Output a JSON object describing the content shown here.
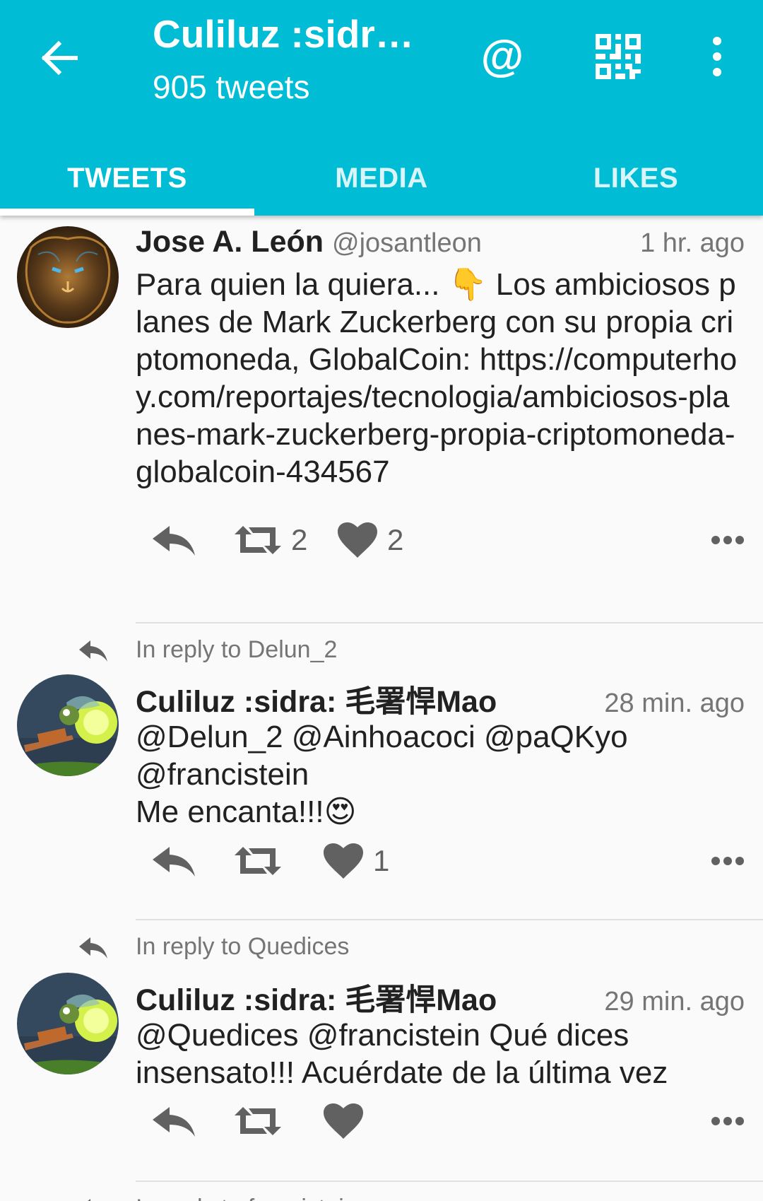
{
  "header": {
    "title": "Culiluz :sidr…",
    "subtitle": "905 tweets"
  },
  "tabs": [
    {
      "label": "TWEETS",
      "active": true
    },
    {
      "label": "MEDIA",
      "active": false
    },
    {
      "label": "LIKES",
      "active": false
    }
  ],
  "colors": {
    "accent": "#00bcd4"
  },
  "tweets": [
    {
      "reply_to": "",
      "name": "Jose A. León",
      "handle": "@josantleon",
      "time": "1 hr. ago",
      "text": "Para quien la quiera... 👇 Los ambiciosos planes de Mark Zuckerberg con su propia criptomoneda, GlobalCoin: https://computerhoy.com/reportajes/tecnologia/ambiciosos-planes-mark-zuckerberg-propia-criptomoneda-globalcoin-434567",
      "retweets": "2",
      "likes": "2"
    },
    {
      "reply_to": "In reply to Delun_2",
      "name": "Culiluz :sidra: 毛署悍Mao",
      "handle": "",
      "time": "28 min. ago",
      "text": "@Delun_2 @Ainhoacoci @paQKyo\n@francistein\nMe encanta!!!😍",
      "retweets": "",
      "likes": "1"
    },
    {
      "reply_to": "In reply to Quedices",
      "name": "Culiluz :sidra: 毛署悍Mao",
      "handle": "",
      "time": "29 min. ago",
      "text": "@Quedices @francistein Qué dices\ninsensato!!! Acuérdate de la última vez",
      "retweets": "",
      "likes": ""
    },
    {
      "reply_to": "In reply to francistein",
      "name": "",
      "handle": "",
      "time": "",
      "text": "",
      "retweets": "",
      "likes": ""
    }
  ]
}
